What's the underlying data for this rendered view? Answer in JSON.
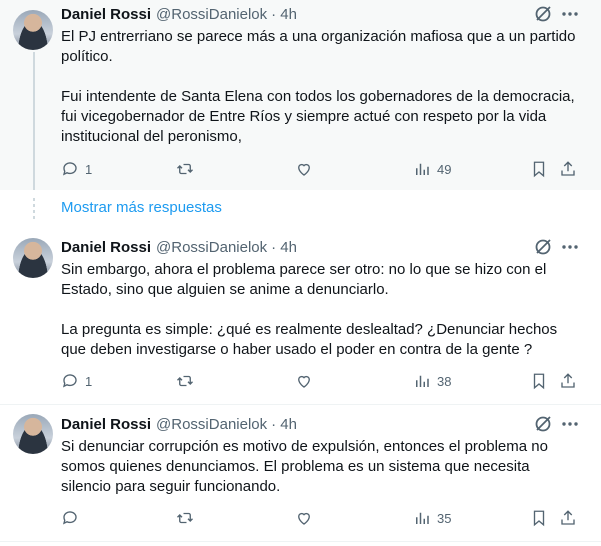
{
  "tweets": [
    {
      "author": "Daniel Rossi",
      "handle": "@RossiDanielok",
      "time": "· 4h",
      "paragraphs": [
        "El PJ entrerriano se parece más a una organización mafiosa que a un partido político.",
        "Fui intendente de Santa Elena con todos los gobernadores de la democracia, fui vicegobernador de Entre Ríos y siempre actué con respeto por la vida institucional del peronismo,"
      ],
      "replies": "1",
      "retweets": "",
      "likes": "",
      "views": "49"
    },
    {
      "author": "Daniel Rossi",
      "handle": "@RossiDanielok",
      "time": "· 4h",
      "paragraphs": [
        "Sin embargo, ahora el problema parece ser otro: no lo que se hizo con el Estado, sino que alguien se anime a denunciarlo.",
        "La pregunta es simple: ¿qué es realmente deslealtad? ¿Denunciar hechos que deben investigarse o haber usado el poder en contra de la gente ?"
      ],
      "replies": "1",
      "retweets": "",
      "likes": "",
      "views": "38"
    },
    {
      "author": "Daniel Rossi",
      "handle": "@RossiDanielok",
      "time": "· 4h",
      "paragraphs": [
        "Si denunciar corrupción es motivo de expulsión, entonces el problema no somos quienes denunciamos. El problema es un sistema que necesita silencio para seguir funcionando."
      ],
      "replies": "",
      "retweets": "",
      "likes": "",
      "views": "35"
    }
  ],
  "show_more_label": "Mostrar más respuestas",
  "colors": {
    "accent": "#1d9bf0",
    "muted": "#536471",
    "highlight_bg": "#f7f9f9"
  },
  "icons": [
    "reply-icon",
    "retweet-icon",
    "like-icon",
    "views-icon",
    "bookmark-icon",
    "share-icon",
    "grok-icon",
    "more-icon"
  ]
}
